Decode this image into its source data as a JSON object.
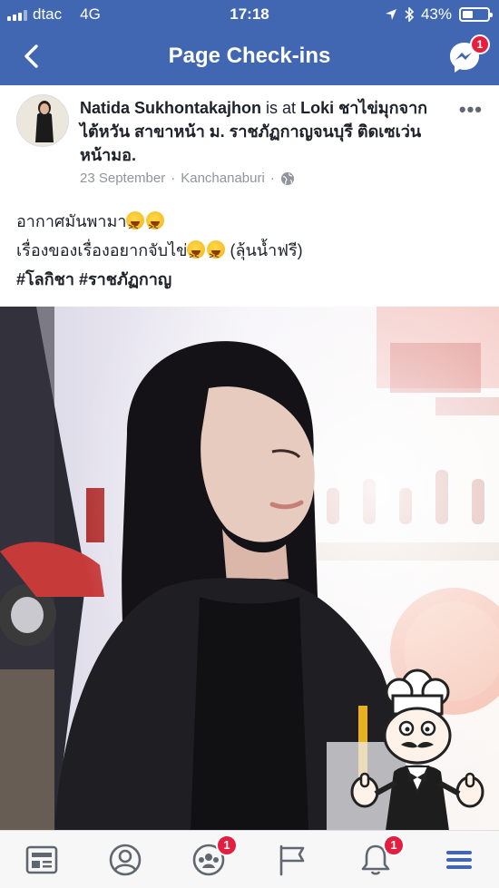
{
  "status_bar": {
    "carrier": "dtac",
    "network": "4G",
    "time": "17:18",
    "battery": "43%",
    "battery_level": 0.43
  },
  "nav": {
    "title": "Page Check-ins",
    "messenger_badge": "1"
  },
  "post": {
    "author": "Natida Sukhontakajhon",
    "is_at": "is at",
    "place": "Loki ชาไข่มุกจากไต้หวัน สาขาหน้า ม. ราชภัฏกาญจนบุรี ติดเซเว่นหน้ามอ.",
    "date": "23 September",
    "separator": "·",
    "location": "Kanchanaburi",
    "text_line1": "อากาศมันพามา",
    "text_line2": "เรื่องของเรื่องอยากจับไข่",
    "text_line2_suffix": "(ลุ้นน้ำฟรี)",
    "hashtag1": "#โลกิชา",
    "hashtag2": "#ราชภัฏกาญ"
  },
  "tabbar": {
    "groups_badge": "1",
    "notifications_badge": "1"
  },
  "icons": [
    "back-icon",
    "messenger-icon",
    "more-options-icon",
    "globe-icon",
    "news-feed-icon",
    "profile-icon",
    "groups-icon",
    "pages-flag-icon",
    "notifications-bell-icon",
    "menu-icon",
    "chef-mascot-icon",
    "grinning-squint-emoji-icon"
  ],
  "colors": {
    "brand_blue": "#4267b2",
    "badge_red": "#e41e3f",
    "menu_active": "#4267b2"
  }
}
